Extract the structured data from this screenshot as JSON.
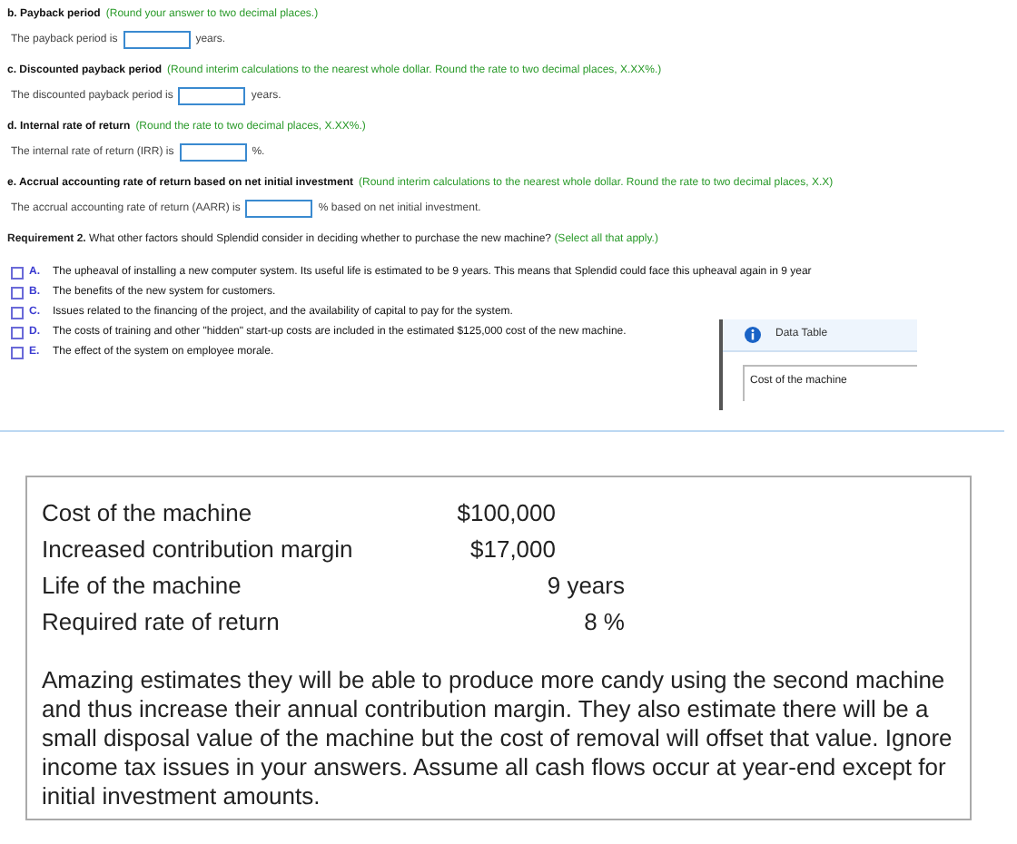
{
  "parts": [
    {
      "label": "b. Payback period",
      "hint": "(Round your answer to two decimal places.)",
      "prompt": "The payback period is",
      "suffix": "years."
    },
    {
      "label": "c. Discounted payback period",
      "hint": "(Round interim calculations to the nearest whole dollar. Round the rate to two decimal places, X.XX%.)",
      "prompt": "The discounted payback period is",
      "suffix": "years."
    },
    {
      "label": "d. Internal rate of return",
      "hint": "(Round the rate to two decimal places, X.XX%.)",
      "prompt": "The internal rate of return (IRR) is",
      "suffix": "%."
    },
    {
      "label": "e. Accrual accounting rate of return based on net initial investment",
      "hint": "(Round interim calculations to the nearest whole dollar. Round the rate to two decimal places, X.X)",
      "prompt": "The accrual accounting rate of return (AARR) is",
      "suffix": "% based on net initial investment."
    }
  ],
  "requirement": {
    "label": "Requirement 2.",
    "question": "What other factors should Splendid consider in deciding whether to purchase the new machine?",
    "hint": "(Select all that apply.)"
  },
  "options": [
    {
      "letter": "A.",
      "text": "The upheaval of installing a new computer system. Its useful life is estimated to be 9 years. This means that Splendid could face this upheaval again in 9 year",
      "checked": false
    },
    {
      "letter": "B.",
      "text": "The benefits of the new system for customers.",
      "checked": false
    },
    {
      "letter": "C.",
      "text": "Issues related to the financing of the project, and the availability of capital to pay for the system.",
      "checked": false
    },
    {
      "letter": "D.",
      "text": "The costs of training and other \"hidden\" start-up costs are included in the estimated $125,000 cost of the new machine.",
      "checked": false
    },
    {
      "letter": "E.",
      "text": "The effect of the system on employee morale.",
      "checked": false
    }
  ],
  "popup": {
    "title": "Data Table",
    "first_row": "Cost of the machine"
  },
  "data_table": {
    "rows": [
      {
        "label": "Cost of the machine",
        "value": "$100,000",
        "kind": "money"
      },
      {
        "label": "Increased contribution margin",
        "value": "$17,000",
        "kind": "money"
      },
      {
        "label": "Life of the machine",
        "value": "9 years",
        "kind": "unit"
      },
      {
        "label": "Required rate of return",
        "value": "8 %",
        "kind": "unit"
      }
    ],
    "note": "Amazing estimates they will be able to produce more candy using the second machine and thus increase their annual contribution margin. They also estimate there will be a small disposal value of the machine but the cost of removal will offset that value. Ignore income tax issues in your answers. Assume all cash flows occur at year-end except for initial investment amounts."
  }
}
